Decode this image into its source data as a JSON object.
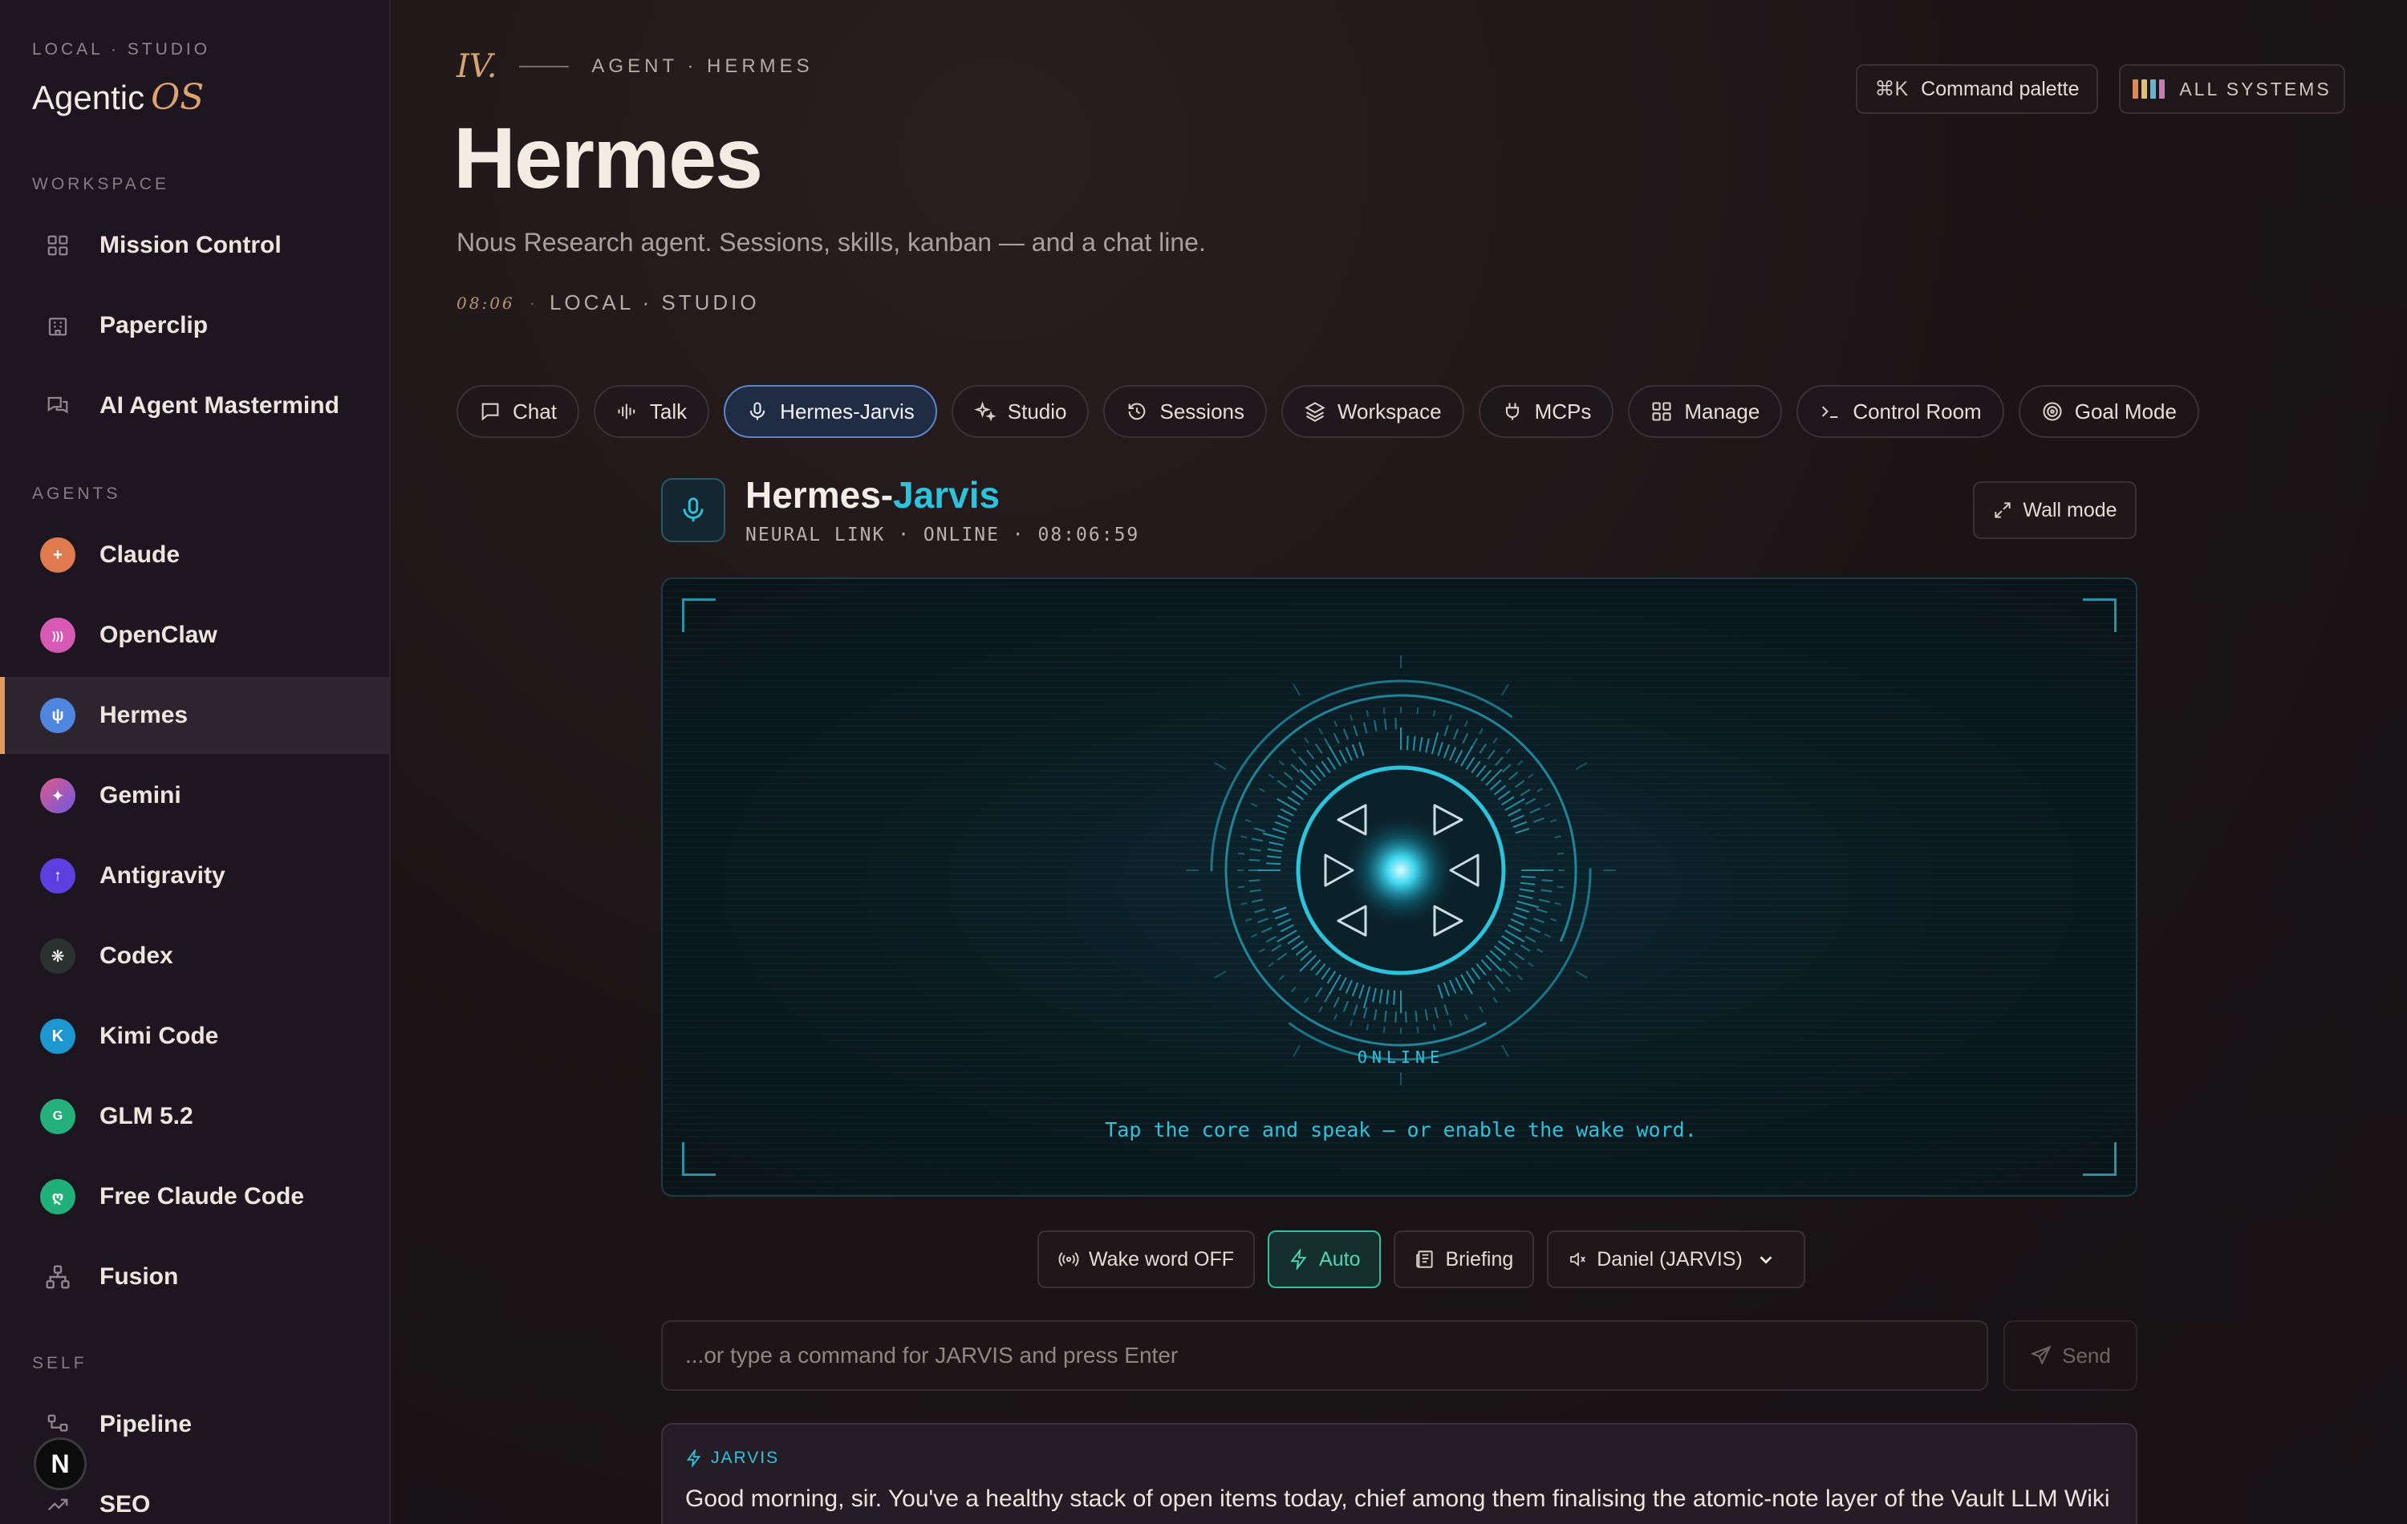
{
  "sidebar": {
    "brand_kicker": "LOCAL · STUDIO",
    "brand_name": "Agentic",
    "brand_suffix": "OS",
    "sections": {
      "workspace": "WORKSPACE",
      "agents": "AGENTS",
      "self": "SELF"
    },
    "workspace_items": [
      {
        "label": "Mission Control",
        "icon": "grid-icon"
      },
      {
        "label": "Paperclip",
        "icon": "building-icon"
      },
      {
        "label": "AI Agent Mastermind",
        "icon": "chat-icon"
      }
    ],
    "agent_items": [
      {
        "label": "Claude",
        "icon": "claude-icon",
        "color": "#e07a4f",
        "glyph": "+"
      },
      {
        "label": "OpenClaw",
        "icon": "openclaw-icon",
        "color": "#d659b3",
        "glyph": ")))"
      },
      {
        "label": "Hermes",
        "icon": "hermes-icon",
        "color": "#4f86e0",
        "glyph": "ψ",
        "active": true
      },
      {
        "label": "Gemini",
        "icon": "gemini-icon",
        "color": "#a15ce0",
        "glyph": "✦"
      },
      {
        "label": "Antigravity",
        "icon": "antigravity-icon",
        "color": "#5b3fe0",
        "glyph": "↑"
      },
      {
        "label": "Codex",
        "icon": "codex-icon",
        "color": "#2a3230",
        "glyph": "❋"
      },
      {
        "label": "Kimi Code",
        "icon": "kimi-icon",
        "color": "#1d97d0",
        "glyph": "K"
      },
      {
        "label": "GLM 5.2",
        "icon": "glm-icon",
        "color": "#23b07a",
        "glyph": "G"
      },
      {
        "label": "Free Claude Code",
        "icon": "free-claude-icon",
        "color": "#22b07a",
        "glyph": "ღ"
      },
      {
        "label": "Fusion",
        "icon": "fusion-icon"
      }
    ],
    "self_items": [
      {
        "label": "Pipeline",
        "icon": "pipeline-icon"
      },
      {
        "label": "SEO",
        "icon": "trend-icon"
      }
    ],
    "avatar_letter": "N"
  },
  "header": {
    "roman": "IV.",
    "eyebrow": "AGENT · HERMES",
    "title": "Hermes",
    "subtitle": "Nous Research agent. Sessions, skills, kanban — and a chat line.",
    "time": "08:06",
    "location": "LOCAL · STUDIO",
    "command_palette_kbd": "⌘K",
    "command_palette_label": "Command palette",
    "systems_label": "ALL SYSTEMS",
    "system_bar_colors": [
      "#d98a5a",
      "#e0c070",
      "#6fb1c8",
      "#c77bb0"
    ]
  },
  "tabs": [
    {
      "label": "Chat",
      "icon": "chat-bubble-icon"
    },
    {
      "label": "Talk",
      "icon": "waveform-icon"
    },
    {
      "label": "Hermes-Jarvis",
      "icon": "mic-icon",
      "active": true
    },
    {
      "label": "Studio",
      "icon": "sparkles-icon"
    },
    {
      "label": "Sessions",
      "icon": "history-icon"
    },
    {
      "label": "Workspace",
      "icon": "layers-icon"
    },
    {
      "label": "MCPs",
      "icon": "plug-icon"
    },
    {
      "label": "Manage",
      "icon": "grid-icon"
    },
    {
      "label": "Control Room",
      "icon": "terminal-icon"
    },
    {
      "label": "Goal Mode",
      "icon": "target-icon"
    }
  ],
  "jarvis": {
    "title_prefix": "Hermes-",
    "title_accent": "Jarvis",
    "status": "NEURAL LINK · ONLINE · 08:06:59",
    "wall_mode_label": "Wall mode",
    "core_state": "ONLINE",
    "hint": "Tap the core and speak — or enable the wake word.",
    "accent_color": "#2cc3dc"
  },
  "controls": {
    "wake_word": "Wake word OFF",
    "auto": "Auto",
    "briefing": "Briefing",
    "voice_selected": "Daniel (JARVIS)"
  },
  "command": {
    "placeholder": "...or type a command for JARVIS and press Enter",
    "send_label": "Send"
  },
  "reply": {
    "speaker": "JARVIS",
    "text": "Good morning, sir. You've a healthy stack of open items today, chief among them finalising the atomic-note layer of the Vault LLM Wiki"
  }
}
